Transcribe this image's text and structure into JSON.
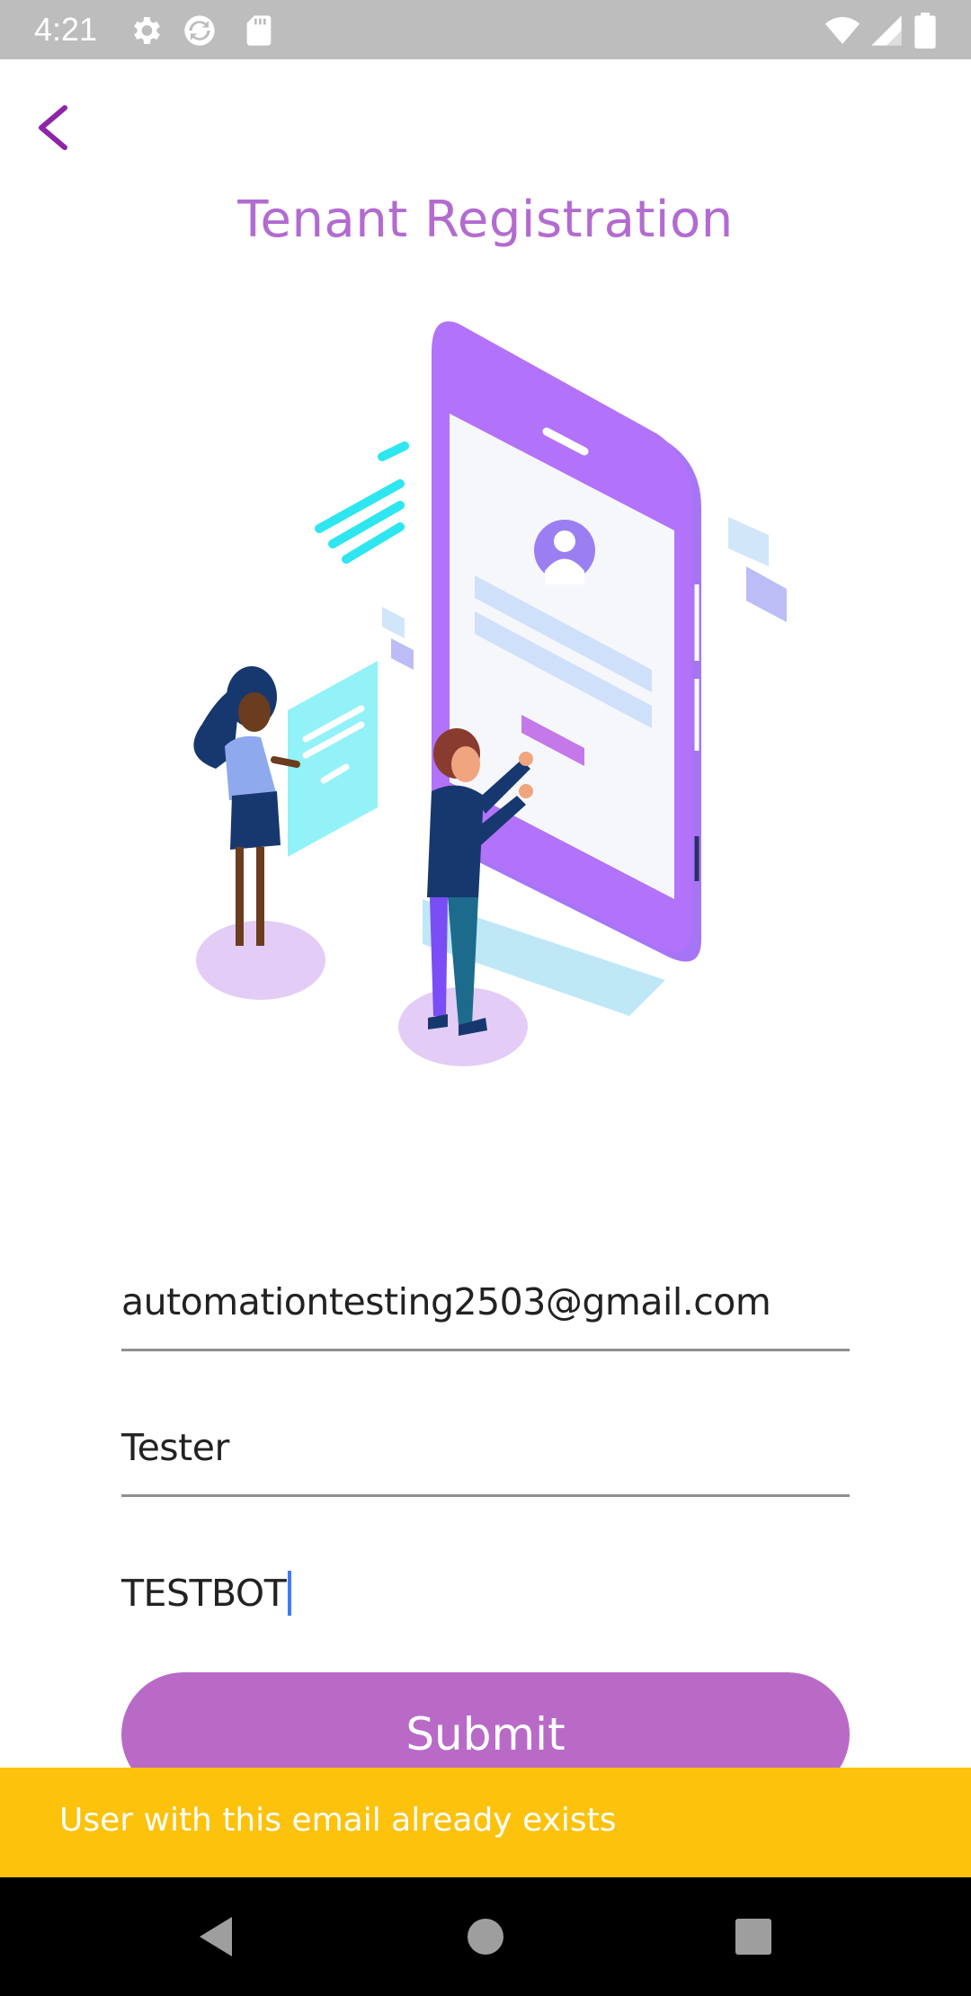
{
  "status_bar": {
    "time": "4:21",
    "left_icons": [
      "gear-icon",
      "sync-icon",
      "sd-card-icon"
    ],
    "right_icons": [
      "wifi-icon",
      "signal-icon",
      "battery-icon"
    ]
  },
  "header": {
    "back_icon": "chevron-left-icon",
    "title": "Tenant Registration"
  },
  "form": {
    "email_value": "automationtesting2503@gmail.com",
    "name_value": "Tester",
    "company_value": "TESTBOT",
    "submit_label": "Submit"
  },
  "snackbar": {
    "message": "User with this email already exists"
  },
  "nav_bar": {
    "icons": [
      "back-triangle-icon",
      "home-circle-icon",
      "recents-square-icon"
    ]
  },
  "colors": {
    "accent": "#b36bd0",
    "button": "#b96ac7",
    "snackbar": "#fcc20c",
    "status_bar": "#bdbdbd",
    "cursor": "#3d7bff"
  }
}
